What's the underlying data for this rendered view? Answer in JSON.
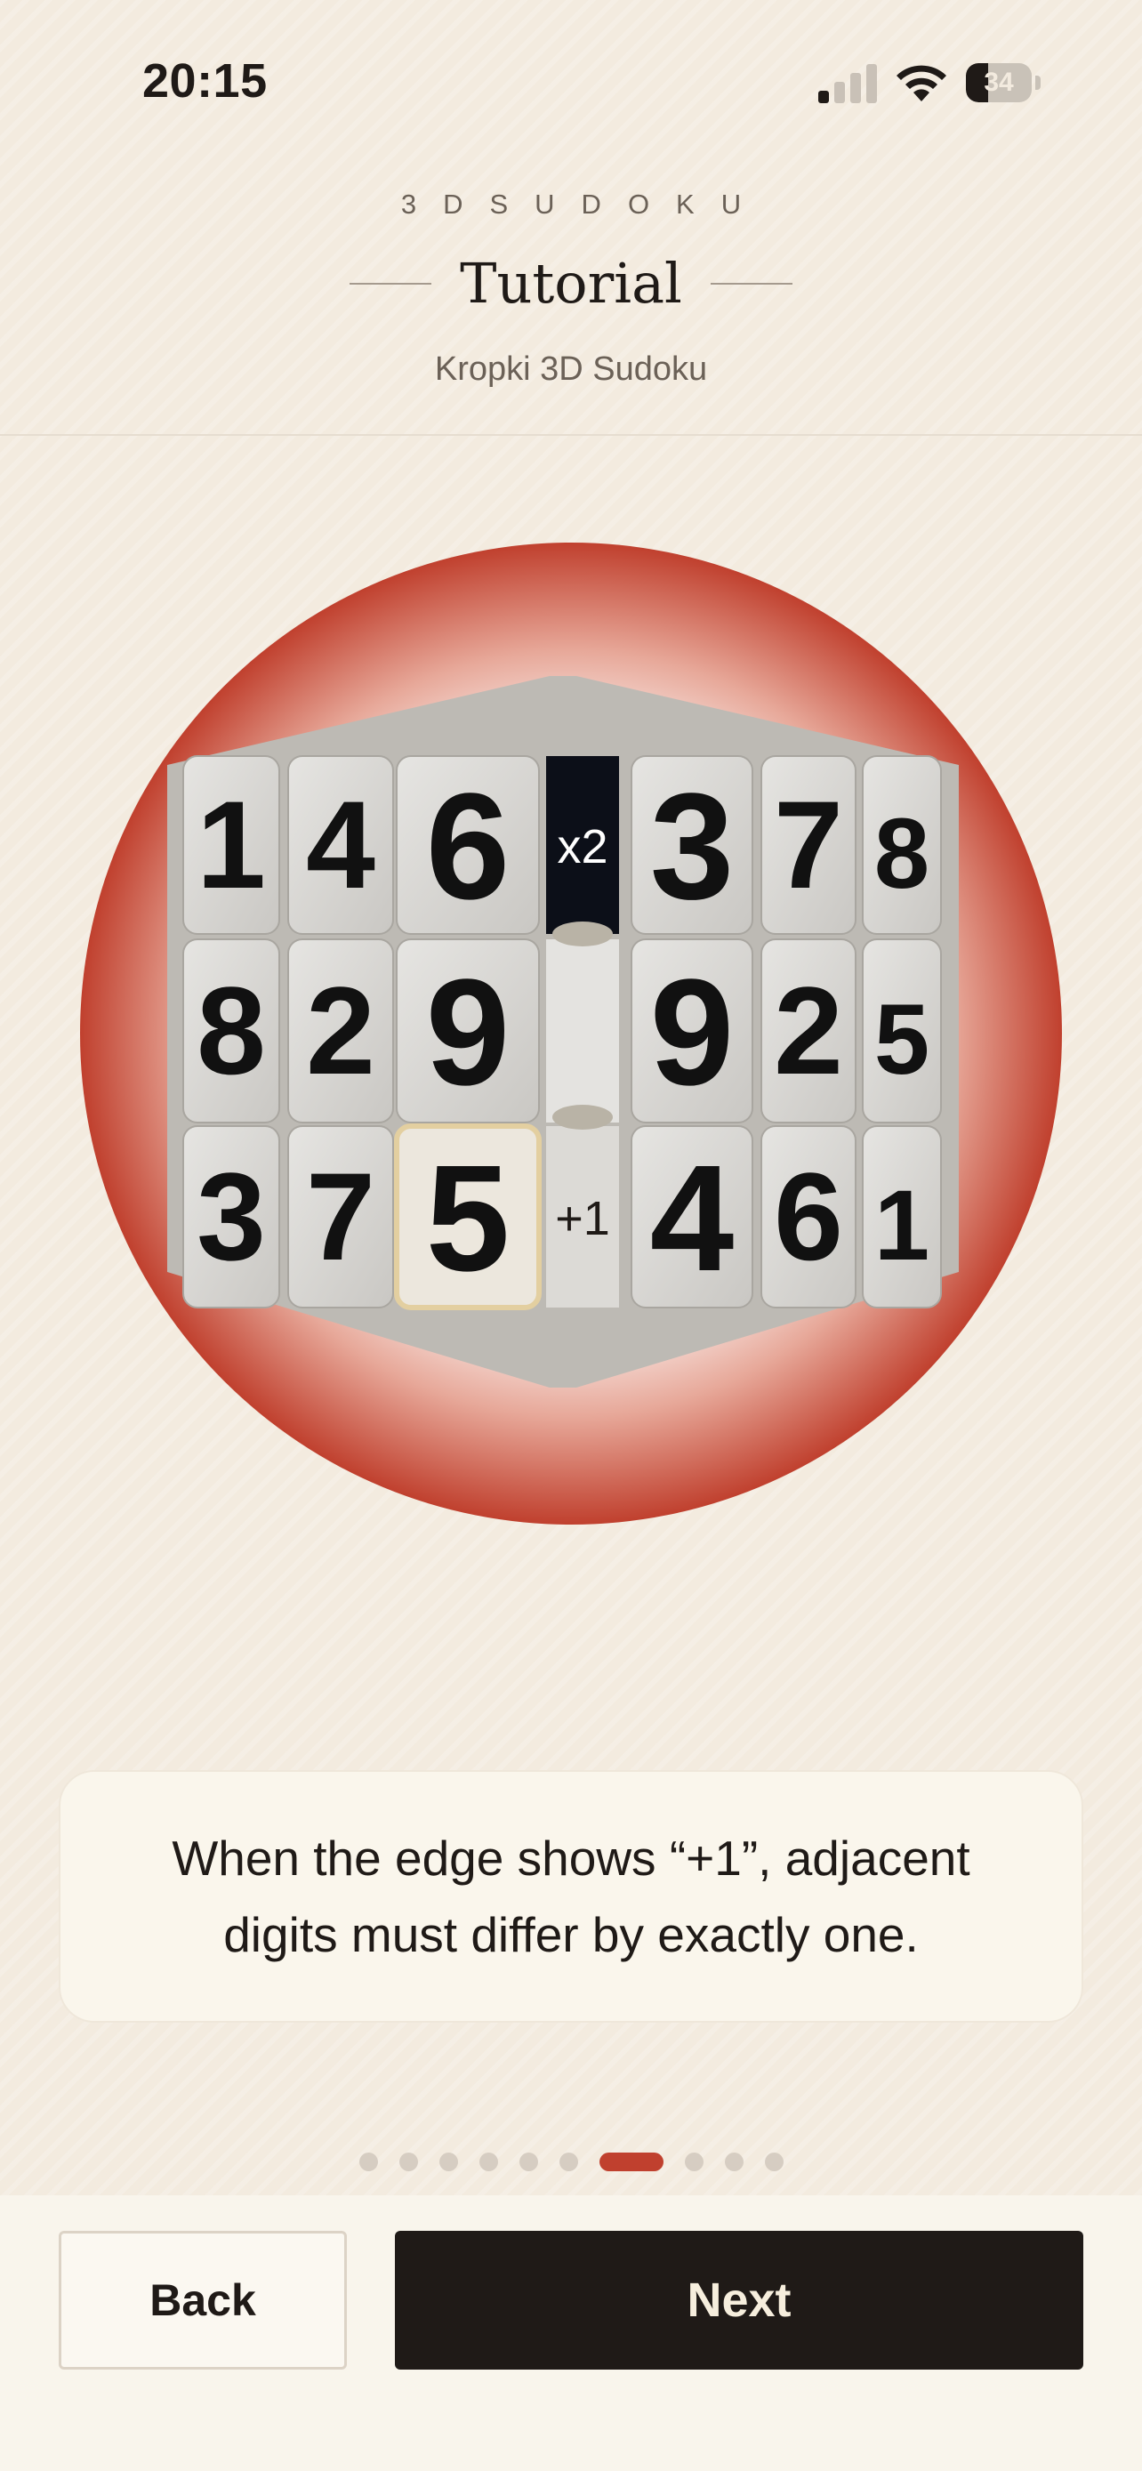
{
  "status_bar": {
    "time": "20:15",
    "battery": "34",
    "battery_level": 0.34,
    "signal_icon": "cellular-signal-icon",
    "wifi_icon": "wifi-icon",
    "battery_icon": "battery-icon"
  },
  "header": {
    "brand": "3DSUDOKU",
    "title": "Tutorial",
    "subtitle": "Kropki 3D Sudoku"
  },
  "cube": {
    "left_face": [
      [
        "1",
        "4",
        "6"
      ],
      [
        "8",
        "2",
        "9"
      ],
      [
        "3",
        "7",
        "5"
      ]
    ],
    "right_face": [
      [
        "3",
        "7",
        "8"
      ],
      [
        "9",
        "2",
        "5"
      ],
      [
        "4",
        "6",
        "1"
      ]
    ],
    "edge_markers": [
      "x2",
      "",
      "+1"
    ],
    "highlighted_cell": "5",
    "colors": {
      "halo": "#c0402e",
      "tile": "#d9d7d3",
      "digit": "#111111",
      "marker_dark": "#0c0f18",
      "highlight": "#e3cfa0"
    }
  },
  "hint": {
    "text": "When the edge shows “+1”, adjacent digits must differ by exactly one."
  },
  "pager": {
    "total": 10,
    "current_index": 7
  },
  "actions": {
    "back_label": "Back",
    "next_label": "Next"
  }
}
